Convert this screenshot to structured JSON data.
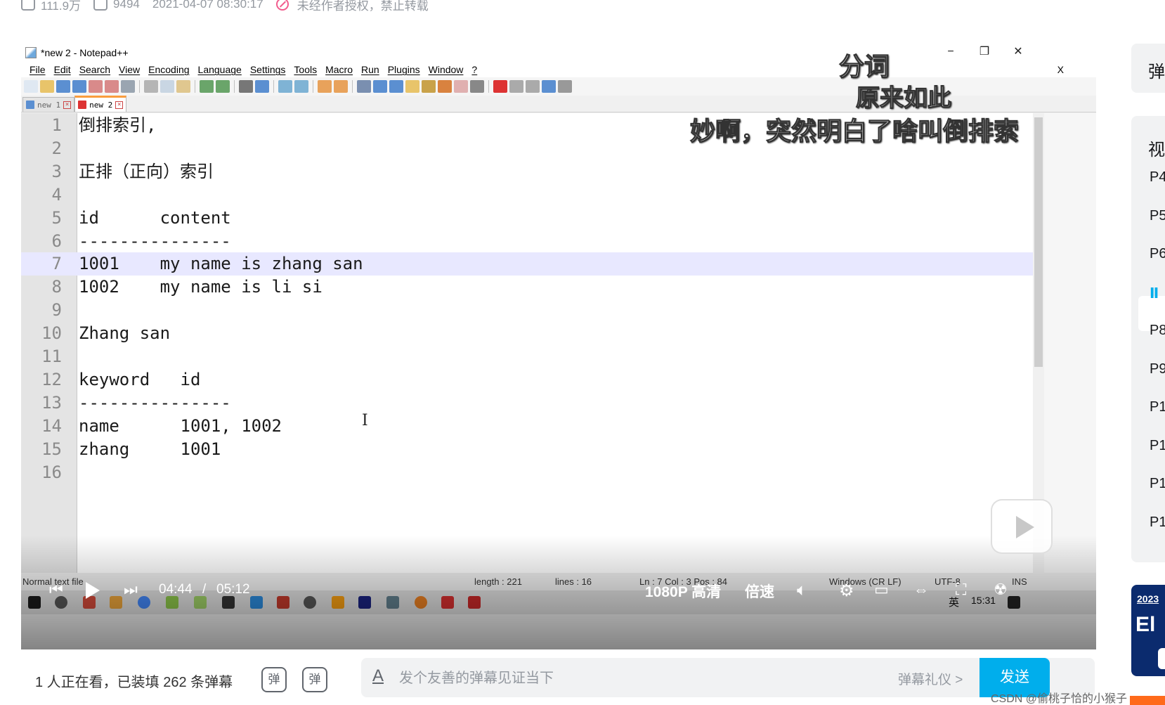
{
  "video_meta": {
    "plays": "111.9万",
    "danmaku_count": "9494",
    "datetime": "2021-04-07 08:30:17",
    "copyright": "未经作者授权，禁止转载"
  },
  "notepad": {
    "title": "*new 2 - Notepad++",
    "menu": [
      "File",
      "Edit",
      "Search",
      "View",
      "Encoding",
      "Language",
      "Settings",
      "Tools",
      "Macro",
      "Run",
      "Plugins",
      "Window",
      "?"
    ],
    "close_x": "X",
    "window_controls": [
      "−",
      "❐",
      "✕"
    ],
    "tabs": [
      {
        "label": "new 1",
        "active": false
      },
      {
        "label": "new 2",
        "active": true
      }
    ],
    "lines": [
      {
        "num": "1",
        "text": "倒排索引,"
      },
      {
        "num": "2",
        "text": ""
      },
      {
        "num": "3",
        "text": "正排（正向）索引"
      },
      {
        "num": "4",
        "text": ""
      },
      {
        "num": "5",
        "text": "id      content"
      },
      {
        "num": "6",
        "text": "---------------"
      },
      {
        "num": "7",
        "text": "1001    my name is zhang san",
        "current": true
      },
      {
        "num": "8",
        "text": "1002    my name is li si"
      },
      {
        "num": "9",
        "text": ""
      },
      {
        "num": "10",
        "text": "Zhang san"
      },
      {
        "num": "11",
        "text": ""
      },
      {
        "num": "12",
        "text": "keyword   id"
      },
      {
        "num": "13",
        "text": "---------------"
      },
      {
        "num": "14",
        "text": "name      1001, 1002"
      },
      {
        "num": "15",
        "text": "zhang     1001"
      },
      {
        "num": "16",
        "text": ""
      }
    ],
    "status": {
      "filetype": "Normal text file",
      "length": "length : 221",
      "lines": "lines : 16",
      "pos": "Ln : 7   Col : 3   Pos : 84",
      "eol": "Windows (CR LF)",
      "encoding": "UTF-8",
      "mode": "INS"
    }
  },
  "taskbar": {
    "ime": "英",
    "time": "15:31"
  },
  "player": {
    "current_time": "04:44",
    "separator": "/",
    "duration": "05:12",
    "quality": "1080P 高清",
    "speed": "倍速"
  },
  "danmaku": [
    "分词",
    "原来如此",
    "妙啊，突然明白了啥叫倒排索"
  ],
  "sendbar": {
    "watching": "1 人正在看，已装填 262 条弹幕",
    "dm_toggle": "弹",
    "dm_settings": "弹",
    "placeholder": "发个友善的弹幕见证当下",
    "etiquette": "弹幕礼仪 >",
    "send": "发送"
  },
  "sidebar": {
    "danmaku_list_label": "弹",
    "playlist_title": "视",
    "episodes": [
      "P4",
      "P5",
      "P6",
      "Ⅱ",
      "P8",
      "P9",
      "P1",
      "P1",
      "P1",
      "P1"
    ],
    "active_index": 3
  },
  "banner": {
    "year": "2023",
    "text": "El"
  },
  "watermark": "CSDN @偷桃子恰的小猴子",
  "colors": {
    "accent": "#00aeec",
    "current_line": "#e8e8ff",
    "tab_highlight": "#fa9d3e"
  }
}
